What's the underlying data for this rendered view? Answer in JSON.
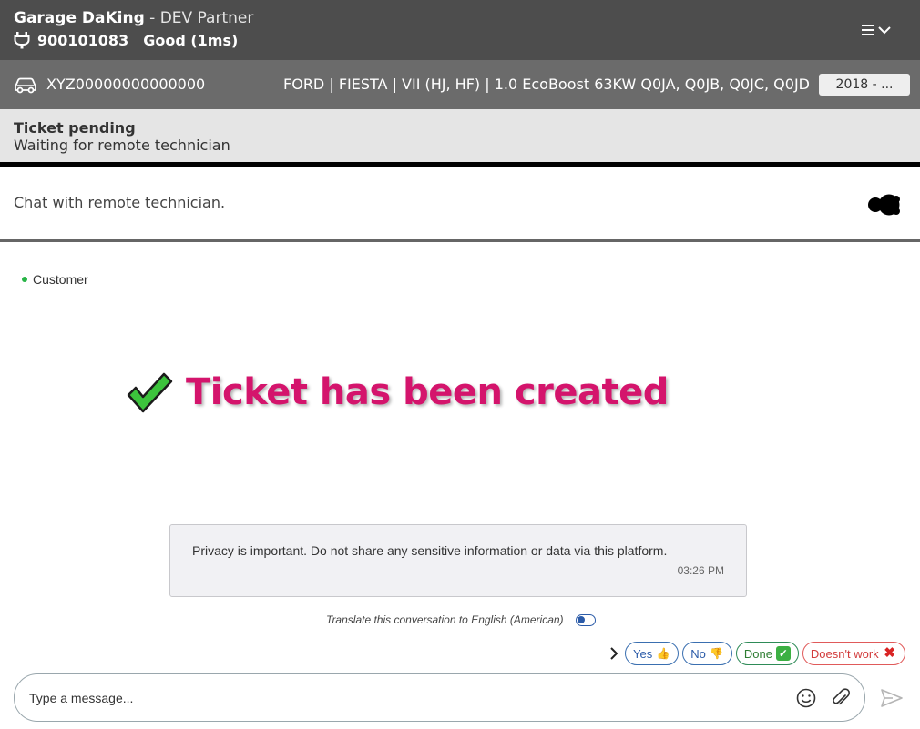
{
  "header": {
    "garage_name": "Garage DaKing",
    "partner": " - DEV Partner",
    "account_id": "900101083",
    "connection_status": "Good (1ms)",
    "menu_icon": "hamburger-menu-icon"
  },
  "vehicle": {
    "vin": "XYZ00000000000000",
    "model": "FORD | FIESTA | VII (HJ, HF) | 1.0 EcoBoost 63KW Q0JA, Q0JB, Q0JC, Q0JD",
    "year": "2018 - ..."
  },
  "ticket": {
    "status_title": "Ticket pending",
    "status_subtitle": "Waiting for remote technician"
  },
  "chat": {
    "title": "Chat with remote technician.",
    "participant": "Customer",
    "participant_status_color": "#28b446",
    "created_banner": "Ticket has been created",
    "created_color": "#d4146c",
    "system_message": "Privacy is important. Do not share any sensitive information or data via this platform.",
    "system_message_time": "03:26 PM",
    "translate_label": "Translate this conversation to English (American)",
    "translate_enabled": false
  },
  "quick_replies": {
    "yes": "Yes",
    "no": "No",
    "done": "Done",
    "doesnt_work": "Doesn't work"
  },
  "composer": {
    "placeholder": "Type a message..."
  }
}
